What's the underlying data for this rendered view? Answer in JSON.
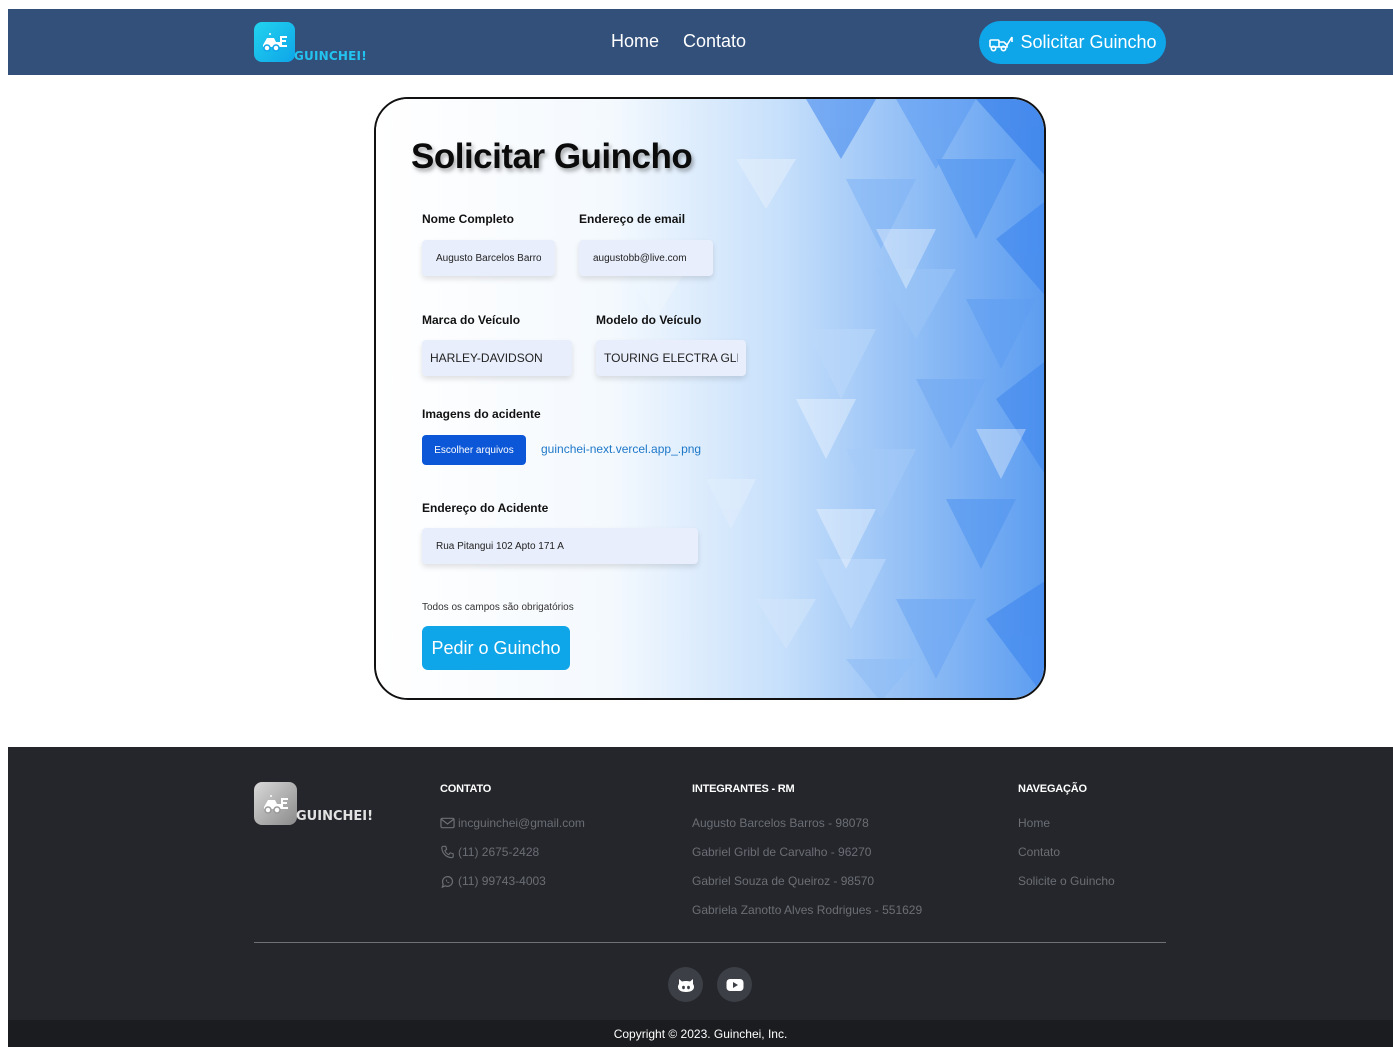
{
  "header": {
    "logo_text": "GUINCHEI!",
    "nav": [
      {
        "label": "Home"
      },
      {
        "label": "Contato"
      }
    ],
    "cta_label": "Solicitar Guincho"
  },
  "form": {
    "title": "Solicitar Guincho",
    "full_name": {
      "label": "Nome Completo",
      "value": "Augusto Barcelos Barros"
    },
    "email": {
      "label": "Endereço de email",
      "value": "augustobb@live.com"
    },
    "brand": {
      "label": "Marca do Veículo",
      "value": "HARLEY-DAVIDSON"
    },
    "model": {
      "label": "Modelo do Veículo",
      "value": "TOURING ELECTRA GLIDE"
    },
    "images": {
      "label": "Imagens do acidente",
      "button_label": "Escolher arquivos",
      "file_name": "guinchei-next.vercel.app_.png"
    },
    "address": {
      "label": "Endereço do Acidente",
      "value": "Rua Pitangui 102 Apto 171 A"
    },
    "note": "Todos os campos são obrigatórios",
    "submit_label": "Pedir o Guincho"
  },
  "footer": {
    "logo_text": "GUINCHEI!",
    "contact": {
      "heading": "CONTATO",
      "items": [
        {
          "icon": "mail-icon",
          "text": "incguinchei@gmail.com"
        },
        {
          "icon": "phone-icon",
          "text": "(11) 2675-2428"
        },
        {
          "icon": "whatsapp-icon",
          "text": "(11) 99743-4003"
        }
      ]
    },
    "members": {
      "heading": "INTEGRANTES - RM",
      "items": [
        "Augusto Barcelos Barros - 98078",
        "Gabriel Gribl de Carvalho - 96270",
        "Gabriel Souza de Queiroz - 98570",
        "Gabriela Zanotto Alves Rodrigues - 551629"
      ]
    },
    "navigation": {
      "heading": "NAVEGAÇÃO",
      "items": [
        "Home",
        "Contato",
        "Solicite o Guincho"
      ]
    },
    "social": [
      "github-icon",
      "youtube-icon"
    ],
    "copyright": "Copyright © 2023. Guinchei, Inc."
  },
  "colors": {
    "header_bg": "#33507b",
    "accent": "#0ea5e9",
    "file_button": "#0b57d8",
    "footer_bg": "#24262b",
    "copyright_bg": "#1b1c1f"
  }
}
